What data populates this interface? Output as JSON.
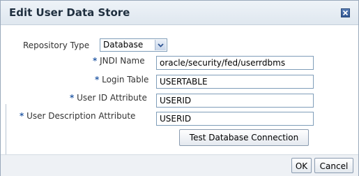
{
  "dialog": {
    "title": "Edit User Data Store",
    "close_icon": "close-icon"
  },
  "form": {
    "repository_type": {
      "label": "Repository Type",
      "value": "Database"
    },
    "jndi_name": {
      "required": "*",
      "label": "JNDI Name",
      "value": "oracle/security/fed/userrdbms"
    },
    "login_table": {
      "required": "*",
      "label": "Login Table",
      "value": "USERTABLE"
    },
    "user_id_attribute": {
      "required": "*",
      "label": "User ID Attribute",
      "value": "USERID"
    },
    "user_description_attribute": {
      "required": "*",
      "label": "User Description Attribute",
      "value": "USERID"
    },
    "test_button": "Test Database Connection"
  },
  "footer": {
    "ok_label": "OK",
    "cancel_label": "Cancel"
  },
  "colors": {
    "required_marker": "#2c5fa8",
    "title_bar": "#dfe7ef",
    "field_border": "#7f9db9"
  }
}
